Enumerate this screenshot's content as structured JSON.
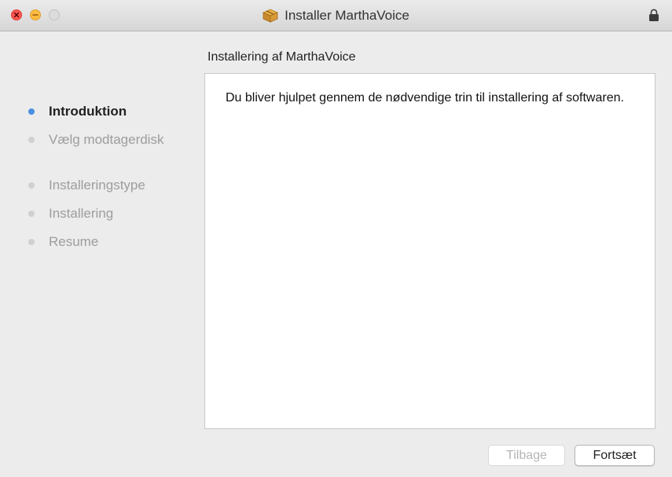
{
  "window": {
    "title": "Installer MarthaVoice",
    "title_icon": "package-icon",
    "lock_icon": "lock-icon"
  },
  "sidebar": {
    "steps": [
      {
        "label": "Introduktion",
        "active": true
      },
      {
        "label": "Vælg modtagerdisk",
        "active": false
      },
      {
        "label": "Installeringstype",
        "active": false
      },
      {
        "label": "Installering",
        "active": false
      },
      {
        "label": "Resume",
        "active": false
      }
    ]
  },
  "content": {
    "heading": "Installering af MarthaVoice",
    "body": "Du bliver hjulpet gennem de nødvendige trin til installering af softwaren."
  },
  "buttons": {
    "back_label": "Tilbage",
    "back_enabled": false,
    "continue_label": "Fortsæt"
  },
  "colors": {
    "active_step": "#4a90e2",
    "inactive_step": "#9d9d9d",
    "close": "#fc5753",
    "minimize": "#fdbc40",
    "zoom": "#dcdcdc"
  }
}
